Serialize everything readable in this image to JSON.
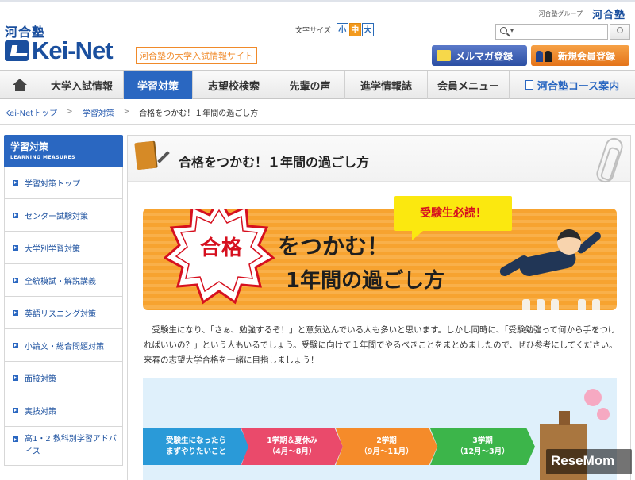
{
  "header": {
    "group_link": "河合塾グループ",
    "group_logo": "河合塾",
    "logo_kanji": "河合塾",
    "logo_main": "Kei-Net",
    "tagline": "河合塾の大学入試情報サイト",
    "font_size_label": "文字サイズ",
    "font_sizes": [
      "小",
      "中",
      "大"
    ],
    "search_placeholder": "",
    "mailmag_label": "メルマガ登録",
    "register_label": "新規会員登録"
  },
  "nav": {
    "items": [
      "大学入試情報",
      "学習対策",
      "志望校検索",
      "先輩の声",
      "進学情報誌",
      "会員メニュー",
      "河合塾コース案内"
    ],
    "active_index": 1
  },
  "breadcrumb": {
    "items": [
      "Kei-Netトップ",
      "学習対策"
    ],
    "current": "合格をつかむ！１年間の過ごし方",
    "separator": ">"
  },
  "sidebar": {
    "title": "学習対策",
    "subtitle": "LEARNING MEASURES",
    "items": [
      "学習対策トップ",
      "センター試験対策",
      "大学別学習対策",
      "全統模試・解説講義",
      "英語リスニング対策",
      "小論文・総合問題対策",
      "面接対策",
      "実技対策",
      "高1・2 教科別学習アドバイス"
    ]
  },
  "main": {
    "page_title": "合格をつかむ！１年間の過ごし方",
    "banner": {
      "badge": "合格",
      "line1": "をつかむ！",
      "line2": "1年間の過ごし方",
      "callout": "受験生必読！"
    },
    "intro": "受験生になり、「さぁ、勉強するぞ！」と意気込んでいる人も多いと思います。しかし同時に、「受験勉強って何から手をつければいいの？」という人もいるでしょう。受験に向けて１年間でやるべきことをまとめましたので、ぜひ参考にしてください。来春の志望大学合格を一緒に目指しましょう！",
    "timeline": [
      {
        "l1": "受験生になったら",
        "l2": "まずやりたいこと"
      },
      {
        "l1": "1学期＆夏休み",
        "l2": "（4月〜8月）"
      },
      {
        "l1": "2学期",
        "l2": "（9月〜11月）"
      },
      {
        "l1": "3学期",
        "l2": "（12月〜3月）"
      }
    ]
  },
  "watermark": "ReseMom"
}
